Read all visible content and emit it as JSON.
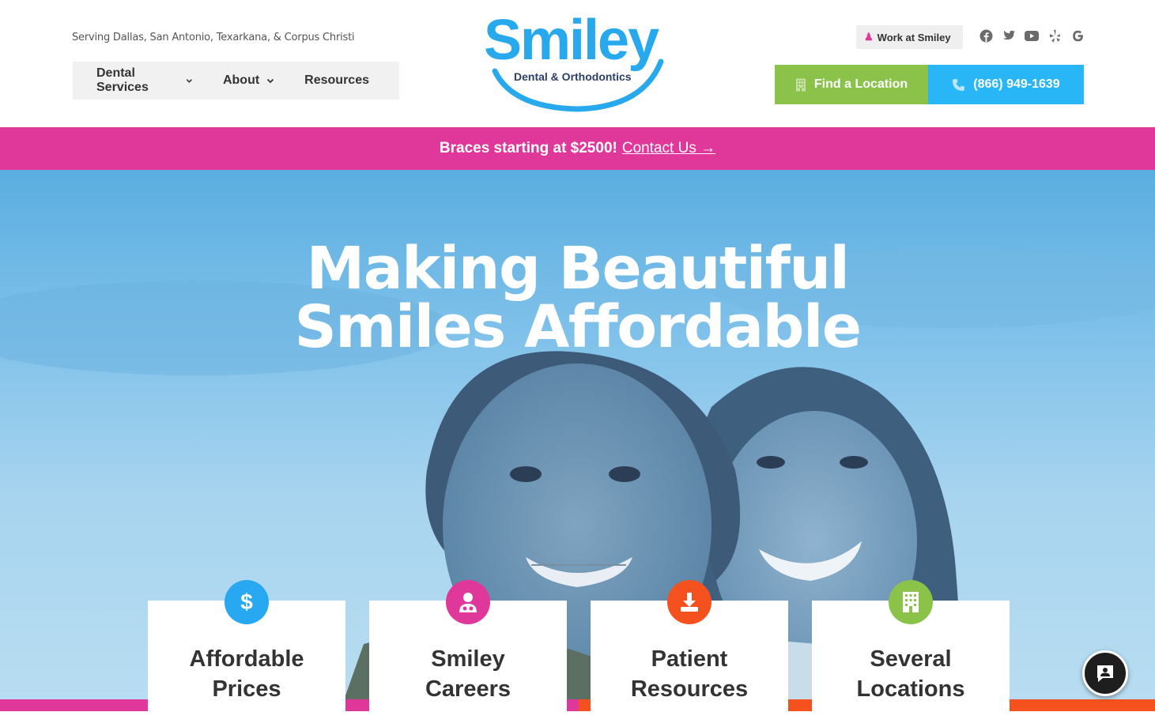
{
  "header": {
    "serving": "Serving Dallas, San Antonio, Texarkana, & Corpus Christi",
    "nav": [
      {
        "label": "Dental Services",
        "has_dropdown": true
      },
      {
        "label": "About",
        "has_dropdown": true
      },
      {
        "label": "Resources",
        "has_dropdown": false
      }
    ],
    "logo": {
      "word": "Smiley",
      "sub": "Dental & Orthodontics"
    },
    "work_label": "Work at Smiley",
    "socials": [
      "facebook-icon",
      "twitter-icon",
      "youtube-icon",
      "yelp-icon",
      "google-icon"
    ],
    "find_label": "Find a Location",
    "phone_label": "(866) 949-1639"
  },
  "promo": {
    "text": "Braces starting at $2500!",
    "link": "Contact Us →"
  },
  "hero": {
    "title_line1": "Making Beautiful",
    "title_line2": "Smiles Affordable"
  },
  "cards": [
    {
      "line1": "Affordable",
      "line2": "Prices",
      "icon": "dollar-icon",
      "color": "#29a8f2"
    },
    {
      "line1": "Smiley",
      "line2": "Careers",
      "icon": "doctor-icon",
      "color": "#e0389a"
    },
    {
      "line1": "Patient",
      "line2": "Resources",
      "icon": "download-icon",
      "color": "#f4511e"
    },
    {
      "line1": "Several",
      "line2": "Locations",
      "icon": "building-icon",
      "color": "#8bc34a"
    }
  ],
  "colors": {
    "pink": "#e0389a",
    "blue": "#29b6f6",
    "green": "#8bc34a",
    "orange": "#f4511e"
  }
}
